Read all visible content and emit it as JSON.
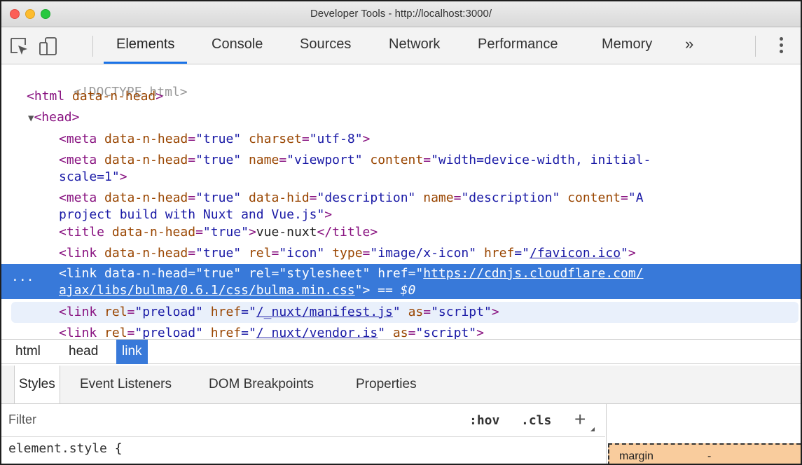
{
  "window": {
    "title": "Developer Tools - http://localhost:3000/"
  },
  "toolbar": {
    "tabs": [
      "Elements",
      "Console",
      "Sources",
      "Network",
      "Performance",
      "Memory"
    ],
    "overflow": "»"
  },
  "dom": {
    "doctype": "<!DOCTYPE html>",
    "l2": {
      "open": "<html ",
      "attr": "data-n-head",
      "close": ">"
    },
    "l3": {
      "arrow": "▼",
      "tag": "<head>"
    },
    "meta1": {
      "t1": "<meta ",
      "a1": "data-n-head",
      "v1": "\"true\"",
      "a2": " charset",
      "v2": "\"utf-8\"",
      "t2": ">"
    },
    "meta2": {
      "t1": "<meta ",
      "a1": "data-n-head",
      "v1": "\"true\"",
      "a2": " name",
      "v2": "\"viewport\"",
      "a3": " content",
      "v3a": "\"width=device-width, initial-",
      "v3b": "scale=1\"",
      "t2": ">"
    },
    "meta3": {
      "t1": "<meta ",
      "a1": "data-n-head",
      "v1": "\"true\"",
      "a2": " data-hid",
      "v2": "\"description\"",
      "a3": " name",
      "v3": "\"description\"",
      "a4": " content",
      "v4a": "\"A",
      "v4b": "project build with Nuxt and Vue.js\"",
      "t2": ">"
    },
    "title": {
      "t1": "<title ",
      "a1": "data-n-head",
      "v1": "\"true\"",
      "t2": ">",
      "text": "vue-nuxt",
      "t3": "</title>"
    },
    "link1": {
      "t1": "<link ",
      "a1": "data-n-head",
      "v1": "\"true\"",
      "a2": " rel",
      "v2": "\"icon\"",
      "a3": " type",
      "v3": "\"image/x-icon\"",
      "a4": " href",
      "q1": "=\"",
      "href": "/favicon.ico",
      "q2": "\"",
      "t2": ">"
    },
    "link2": {
      "dots": "...",
      "t1": "<link ",
      "a1": "data-n-head",
      "v1": "\"true\"",
      "a2": " rel",
      "v2": "\"stylesheet\"",
      "a3": " href",
      "q1": "=\"",
      "hrefa": "https://cdnjs.cloudflare.com/",
      "hrefb": "ajax/libs/bulma/0.6.1/css/bulma.min.css",
      "q2": "\"",
      "t2": ">",
      "eq": " == $0"
    },
    "link3": {
      "t1": "<link ",
      "a1": "rel",
      "v1": "\"preload\"",
      "a2": " href",
      "q1": "=\"",
      "href": "/_nuxt/manifest.js",
      "q2": "\"",
      "a3": " as",
      "v3": "\"script\"",
      "t2": ">"
    },
    "link4": {
      "t1": "<link ",
      "a1": "rel",
      "v1": "\"preload\"",
      "a2": " href",
      "q1": "=\"",
      "href": "/ nuxt/vendor.is",
      "q2": "\"",
      "a3": " as",
      "v3": "\"script\"",
      "t2": ">"
    }
  },
  "breadcrumbs": [
    "html",
    "head",
    "link"
  ],
  "styles": {
    "tabs": [
      "Styles",
      "Event Listeners",
      "DOM Breakpoints",
      "Properties"
    ],
    "filter_placeholder": "Filter",
    "hov": ":hov",
    "cls": ".cls",
    "plus": "+",
    "element_style": "element.style",
    "brace": "{"
  },
  "box_model": {
    "label": "margin",
    "value": "-"
  },
  "colors": {
    "selection": "#3879d9",
    "tab_underline": "#1a73e8",
    "margin_fill": "#f9cc9d"
  }
}
